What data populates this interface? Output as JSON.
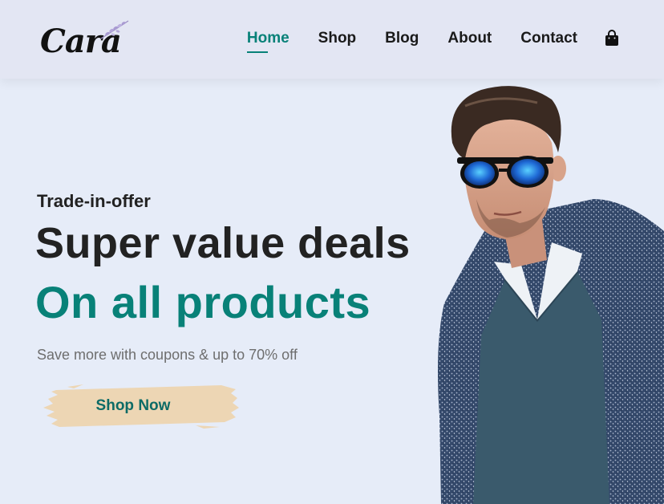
{
  "brand": {
    "name": "Cara",
    "accent": "#088178",
    "text": "#222222"
  },
  "nav": {
    "items": [
      {
        "label": "Home",
        "active": true
      },
      {
        "label": "Shop",
        "active": false
      },
      {
        "label": "Blog",
        "active": false
      },
      {
        "label": "About",
        "active": false
      },
      {
        "label": "Contact",
        "active": false
      }
    ],
    "cart_icon": "shopping-bag-icon"
  },
  "hero": {
    "eyebrow": "Trade-in-offer",
    "headline": "Super value deals",
    "subheadline": "On all products",
    "description": "Save more with coupons & up to 70% off",
    "cta_label": "Shop Now",
    "cta_background": "#edd6b4",
    "image": "male-model-sunglasses-cardigan"
  }
}
